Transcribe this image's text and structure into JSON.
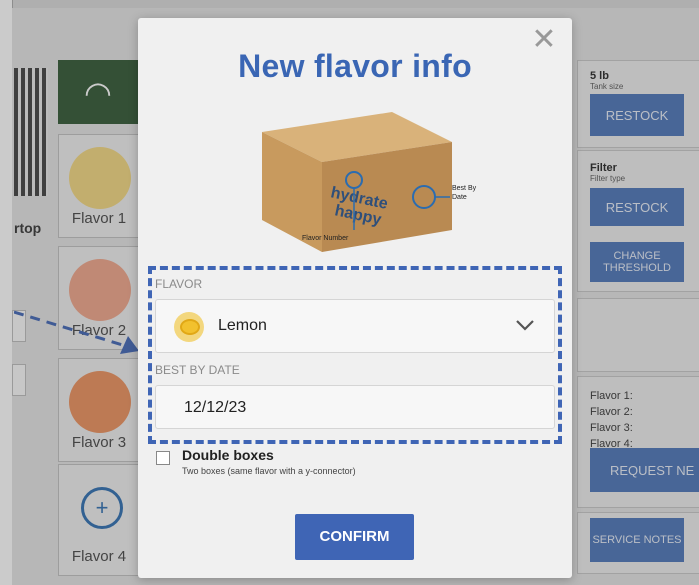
{
  "background": {
    "left_label": "rtop",
    "tiles": [
      {
        "label": "Flavor 1",
        "color": "#f2c12e"
      },
      {
        "label": "Flavor 2",
        "color": "#e9825a"
      },
      {
        "label": "Flavor 3",
        "color": "#e46b3b"
      },
      {
        "label": "Flavor 4",
        "color": "#2b6cb0"
      }
    ],
    "tank_size": {
      "value": "5 lb",
      "sub": "Tank size",
      "button": "RESTOCK"
    },
    "filter": {
      "value": "Filter",
      "sub": "Filter type",
      "button": "RESTOCK",
      "button2": "CHANGE THRESHOLD"
    },
    "flavor_list": [
      "Flavor 1:",
      "Flavor 2:",
      "Flavor 3:",
      "Flavor 4:"
    ],
    "request_button": "REQUEST NE",
    "service_button": "SERVICE NOTES"
  },
  "modal": {
    "title": "New flavor info",
    "close_icon": "close-icon",
    "image": {
      "brand": "hydrate happy",
      "callout_best_by": "Best By Date",
      "callout_flavor_number": "Flavor Number"
    },
    "flavor_label": "FLAVOR",
    "flavor_value": "Lemon",
    "best_by_label": "BEST BY DATE",
    "best_by_value": "12/12/23",
    "double_boxes_title": "Double boxes",
    "double_boxes_sub": "Two boxes (same flavor with a y-connector)",
    "confirm_label": "CONFIRM",
    "accent_color": "#3f65b5"
  }
}
